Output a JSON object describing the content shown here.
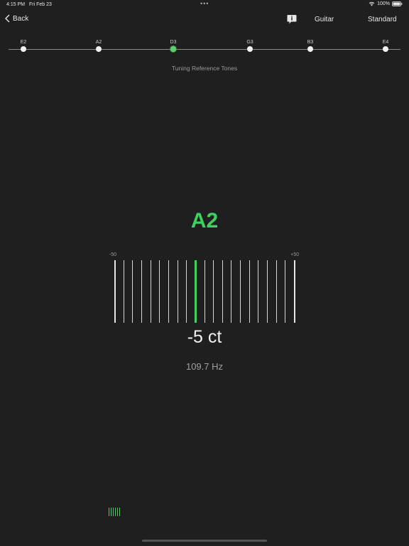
{
  "status": {
    "time": "4:15 PM",
    "date": "Fri Feb 23",
    "battery": "100%"
  },
  "nav": {
    "back_label": "Back",
    "instrument": "Guitar",
    "tuning": "Standard"
  },
  "strings": [
    {
      "label": "E2",
      "active": false
    },
    {
      "label": "A2",
      "active": false
    },
    {
      "label": "D3",
      "active": true
    },
    {
      "label": "G3",
      "active": false
    },
    {
      "label": "B3",
      "active": false
    },
    {
      "label": "E4",
      "active": false
    }
  ],
  "reference_tones_label": "Tuning Reference Tones",
  "tuner": {
    "note": "A2",
    "meter_min_label": "-50",
    "meter_max_label": "+50",
    "meter_min": -50,
    "meter_max": 50,
    "cents_value": -5,
    "cents_label": "-5 ct",
    "frequency_label": "109.7 Hz"
  },
  "colors": {
    "accent": "#3ed15f",
    "background": "#1f1f1f"
  }
}
